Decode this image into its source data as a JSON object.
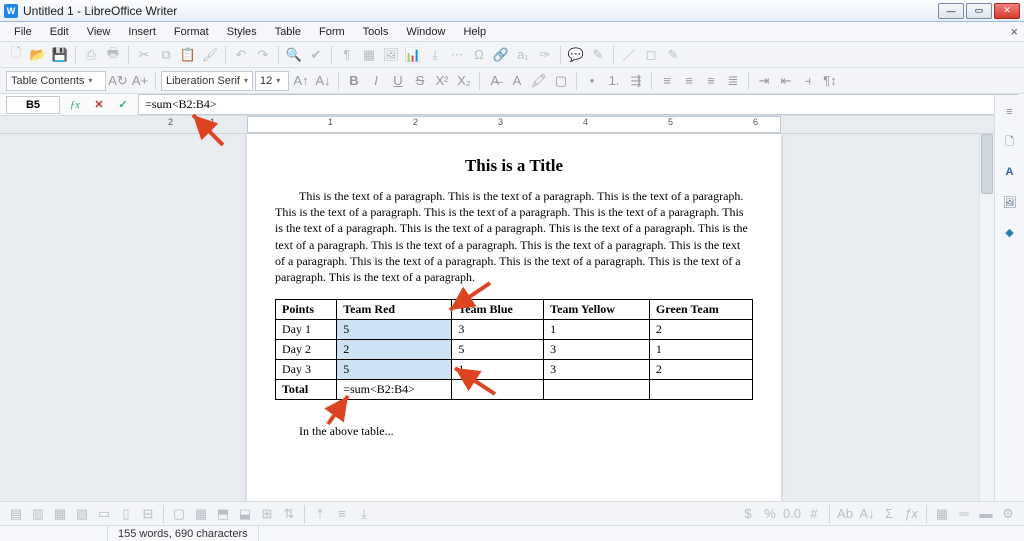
{
  "window": {
    "title": "Untitled 1 - LibreOffice Writer"
  },
  "menus": [
    "File",
    "Edit",
    "View",
    "Insert",
    "Format",
    "Styles",
    "Table",
    "Form",
    "Tools",
    "Window",
    "Help"
  ],
  "style_dropdown": "Table Contents",
  "font_dropdown": "Liberation Serif",
  "size_dropdown": "12",
  "formula": {
    "cell": "B5",
    "value": "=sum<B2:B4>"
  },
  "doc": {
    "title": "This is a Title",
    "paragraph": "This is the text of a paragraph.  This is the text of a paragraph.  This is the text of a paragraph.  This is the text of a paragraph.  This is the text of a paragraph.  This is the text of a paragraph.  This is the text of a paragraph.  This is the text of a paragraph.  This is the text of a paragraph.  This is the text of a paragraph.  This is the text of a paragraph.  This is the text of a paragraph.  This is the text of a paragraph.  This is the text of a paragraph.  This is the text of a paragraph.  This is the text of a paragraph.  This is the text of a paragraph.",
    "caption": "In the above table..."
  },
  "table": {
    "headers": [
      "Points",
      "Team Red",
      "Team Blue",
      "Team Yellow",
      "Green Team"
    ],
    "rows": [
      {
        "label": "Day 1",
        "r": "5",
        "b": "3",
        "y": "1",
        "g": "2"
      },
      {
        "label": "Day 2",
        "r": "2",
        "b": "5",
        "y": "3",
        "g": "1"
      },
      {
        "label": "Day 3",
        "r": "5",
        "b": "1",
        "y": "3",
        "g": "2"
      }
    ],
    "total_label": "Total",
    "total_formula": "=sum<B2:B4>"
  },
  "ruler_ticks": [
    "1",
    "2",
    "1",
    "2",
    "3",
    "4",
    "5",
    "6"
  ],
  "status": {
    "words": "155 words, 690 characters"
  }
}
